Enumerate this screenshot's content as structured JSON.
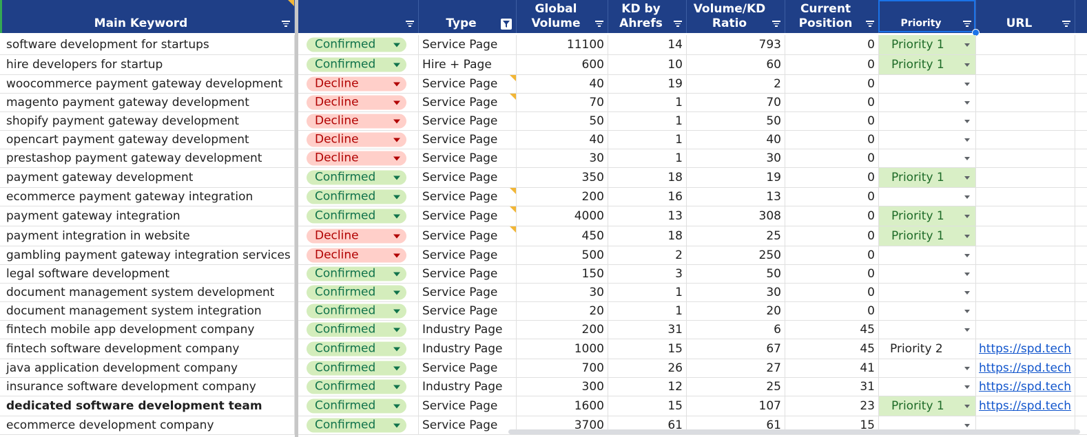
{
  "headers": {
    "keyword": "Main Keyword",
    "status": "",
    "type": "Type",
    "volume": "Global Volume",
    "kd": "KD by Ahrefs",
    "ratio": "Volume/KD Ratio",
    "position": "Current Position",
    "priority": "Priority",
    "url": "URL"
  },
  "colors": {
    "header_bg": "#1f3f87",
    "confirmed_bg": "#d4edbc",
    "confirmed_text": "#11734b",
    "decline_bg": "#ffcfc9",
    "decline_text": "#b10202",
    "priority_bg": "#d9efc6",
    "link": "#1155cc"
  },
  "rows": [
    {
      "keyword": "software development for startups",
      "status": "Confirmed",
      "type": "Service Page",
      "volume": "11100",
      "kd": "14",
      "ratio": "793",
      "position": "0",
      "priority": "Priority 1",
      "url": ""
    },
    {
      "keyword": "hire developers for startup",
      "status": "Confirmed",
      "type": "Hire + Page",
      "volume": "600",
      "kd": "10",
      "ratio": "60",
      "position": "0",
      "priority": "Priority 1",
      "url": ""
    },
    {
      "keyword": "woocommerce payment gateway development",
      "status": "Decline",
      "type": "Service Page",
      "volume": "40",
      "kd": "19",
      "ratio": "2",
      "position": "0",
      "priority": "",
      "url": ""
    },
    {
      "keyword": "magento payment gateway development",
      "status": "Decline",
      "type": "Service Page",
      "volume": "70",
      "kd": "1",
      "ratio": "70",
      "position": "0",
      "priority": "",
      "url": ""
    },
    {
      "keyword": "shopify payment gateway development",
      "status": "Decline",
      "type": "Service Page",
      "volume": "50",
      "kd": "1",
      "ratio": "50",
      "position": "0",
      "priority": "",
      "url": ""
    },
    {
      "keyword": "opencart payment gateway development",
      "status": "Decline",
      "type": "Service Page",
      "volume": "40",
      "kd": "1",
      "ratio": "40",
      "position": "0",
      "priority": "",
      "url": ""
    },
    {
      "keyword": "prestashop payment gateway development",
      "status": "Decline",
      "type": "Service Page",
      "volume": "30",
      "kd": "1",
      "ratio": "30",
      "position": "0",
      "priority": "",
      "url": ""
    },
    {
      "keyword": "payment gateway development",
      "status": "Confirmed",
      "type": "Service Page",
      "volume": "350",
      "kd": "18",
      "ratio": "19",
      "position": "0",
      "priority": "Priority 1",
      "url": ""
    },
    {
      "keyword": "ecommerce payment gateway integration",
      "status": "Confirmed",
      "type": "Service Page",
      "volume": "200",
      "kd": "16",
      "ratio": "13",
      "position": "0",
      "priority": "",
      "url": ""
    },
    {
      "keyword": "payment gateway integration",
      "status": "Confirmed",
      "type": "Service Page",
      "volume": "4000",
      "kd": "13",
      "ratio": "308",
      "position": "0",
      "priority": "Priority 1",
      "url": ""
    },
    {
      "keyword": "payment integration in website",
      "status": "Decline",
      "type": "Service Page",
      "volume": "450",
      "kd": "18",
      "ratio": "25",
      "position": "0",
      "priority": "Priority 1",
      "url": ""
    },
    {
      "keyword": "gambling payment gateway integration services",
      "status": "Decline",
      "type": "Service Page",
      "volume": "500",
      "kd": "2",
      "ratio": "250",
      "position": "0",
      "priority": "",
      "url": ""
    },
    {
      "keyword": "legal software development",
      "status": "Confirmed",
      "type": "Service Page",
      "volume": "150",
      "kd": "3",
      "ratio": "50",
      "position": "0",
      "priority": "",
      "url": ""
    },
    {
      "keyword": "document management system development",
      "status": "Confirmed",
      "type": "Service Page",
      "volume": "30",
      "kd": "1",
      "ratio": "30",
      "position": "0",
      "priority": "",
      "url": ""
    },
    {
      "keyword": "document management system integration",
      "status": "Confirmed",
      "type": "Service Page",
      "volume": "20",
      "kd": "1",
      "ratio": "20",
      "position": "0",
      "priority": "",
      "url": ""
    },
    {
      "keyword": "fintech mobile app development company",
      "status": "Confirmed",
      "type": "Industry Page",
      "volume": "200",
      "kd": "31",
      "ratio": "6",
      "position": "45",
      "priority": "",
      "url": ""
    },
    {
      "keyword": "fintech software development company",
      "status": "Confirmed",
      "type": "Industry Page",
      "volume": "1000",
      "kd": "15",
      "ratio": "67",
      "position": "45",
      "priority": "Priority 2",
      "url": "https://spd.tech"
    },
    {
      "keyword": "java application development company",
      "status": "Confirmed",
      "type": "Service Page",
      "volume": "700",
      "kd": "26",
      "ratio": "27",
      "position": "41",
      "priority": "",
      "url": "https://spd.tech"
    },
    {
      "keyword": "insurance software development company",
      "status": "Confirmed",
      "type": "Industry Page",
      "volume": "300",
      "kd": "12",
      "ratio": "25",
      "position": "31",
      "priority": "",
      "url": "https://spd.tech"
    },
    {
      "keyword": "dedicated software development team",
      "status": "Confirmed",
      "type": "Service Page",
      "volume": "1600",
      "kd": "15",
      "ratio": "107",
      "position": "23",
      "priority": "Priority 1",
      "url": "https://spd.tech"
    },
    {
      "keyword": "ecommerce development company",
      "status": "Confirmed",
      "type": "Service Page",
      "volume": "3700",
      "kd": "61",
      "ratio": "61",
      "position": "15",
      "priority": "",
      "url": ""
    }
  ]
}
